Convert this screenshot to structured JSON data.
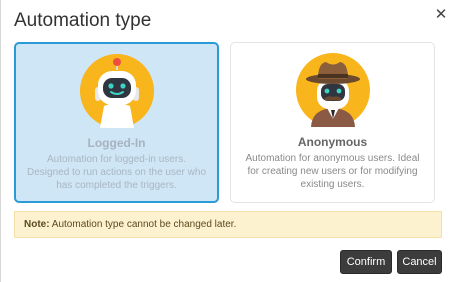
{
  "dialog": {
    "title": "Automation type",
    "close_icon": "close-icon"
  },
  "cards": [
    {
      "title": "Logged-In",
      "description": "Automation for logged-in users. Designed to run actions on the user who has completed the triggers.",
      "icon": "robot-icon",
      "selected": true
    },
    {
      "title": "Anonymous",
      "description": "Automation for anonymous users. Ideal for creating new users or for modifying existing users.",
      "icon": "spy-icon",
      "selected": false
    }
  ],
  "note": {
    "label": "Note:",
    "text": " Automation type cannot be changed later."
  },
  "buttons": {
    "confirm": "Confirm",
    "cancel": "Cancel"
  },
  "colors": {
    "accent": "#2a9bd7",
    "selected_bg": "#cfe6f6",
    "note_bg": "#fdf2cf",
    "button_bg": "#3c3c3c",
    "avatar_bg": "#f8b51c"
  }
}
